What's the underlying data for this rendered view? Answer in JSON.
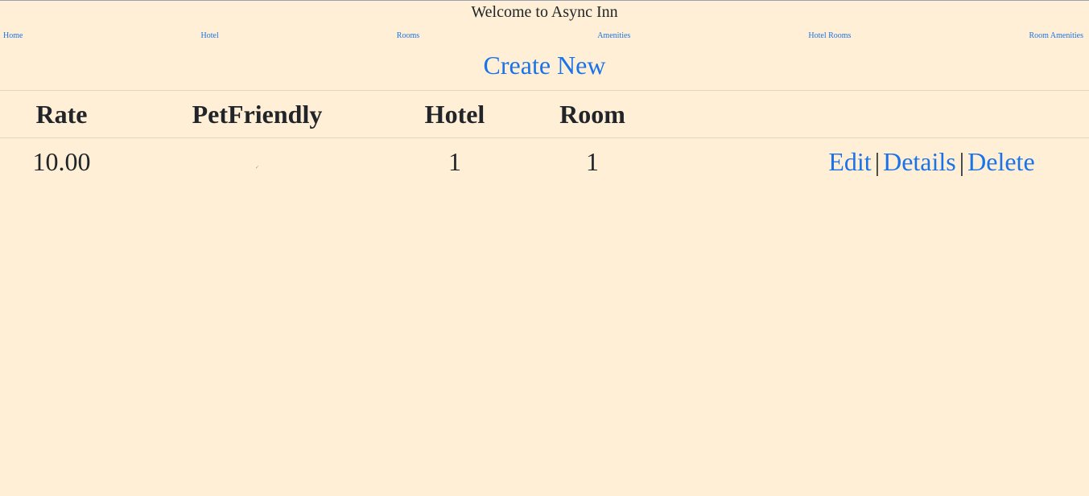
{
  "header": {
    "title": "Welcome to Async Inn"
  },
  "nav": {
    "items": [
      {
        "label": "Home"
      },
      {
        "label": "Hotel"
      },
      {
        "label": "Rooms"
      },
      {
        "label": "Amenities"
      },
      {
        "label": "Hotel Rooms"
      },
      {
        "label": "Room Amenities"
      }
    ]
  },
  "main": {
    "create_new_label": "Create New",
    "table": {
      "columns": [
        "Rate",
        "PetFriendly",
        "Hotel",
        "Room",
        ""
      ],
      "rows": [
        {
          "rate": "10.00",
          "pet_friendly": true,
          "hotel": "1",
          "room": "1",
          "actions": {
            "edit": "Edit",
            "details": "Details",
            "delete": "Delete",
            "separator": "|"
          }
        }
      ]
    }
  },
  "colors": {
    "background": "#ffefd6",
    "link": "#1a73e8",
    "text": "#212529"
  }
}
